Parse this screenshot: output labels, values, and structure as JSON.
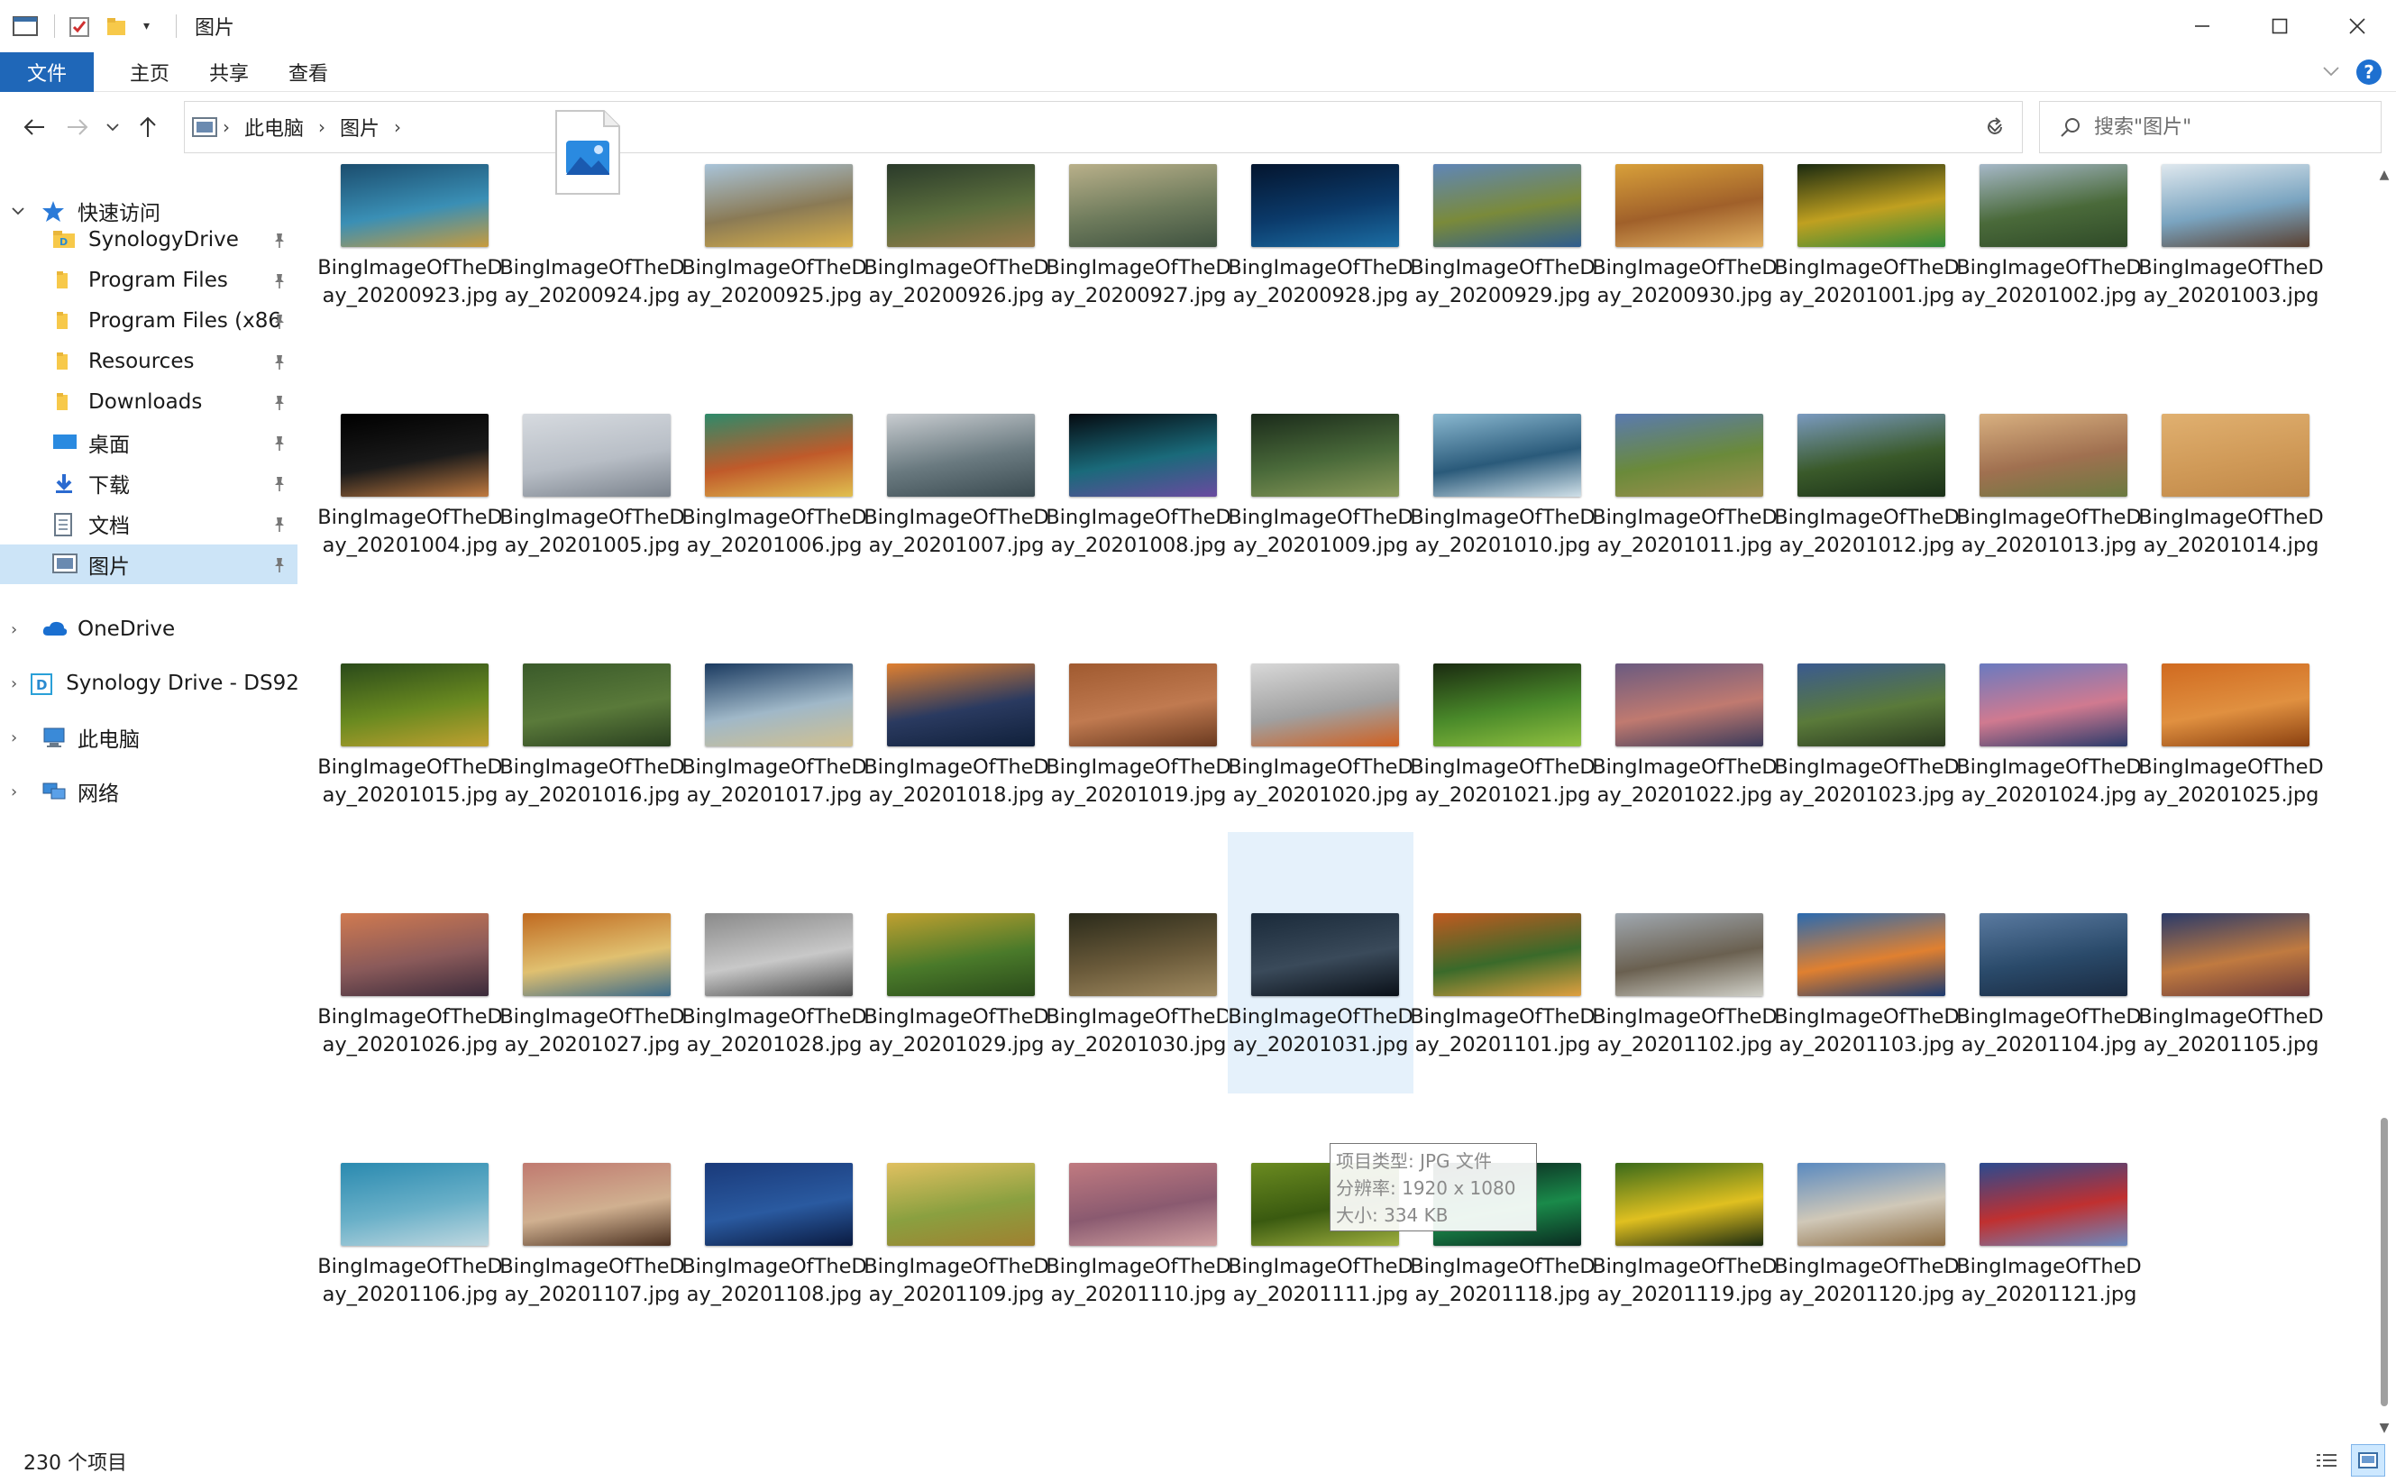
{
  "window": {
    "title": "图片",
    "controls": [
      "minimize",
      "maximize",
      "close"
    ]
  },
  "ribbon": {
    "file_tab": "文件",
    "tabs": [
      "主页",
      "共享",
      "查看"
    ]
  },
  "address": {
    "crumbs": [
      "此电脑",
      "图片"
    ]
  },
  "search": {
    "placeholder": "搜索\"图片\""
  },
  "nav_pane": {
    "quick_access": "快速访问",
    "pinned": [
      {
        "label": "SynologyDrive",
        "icon": "synology-folder-icon"
      },
      {
        "label": "Program Files",
        "icon": "folder-icon"
      },
      {
        "label": "Program Files (x86",
        "icon": "folder-icon"
      },
      {
        "label": "Resources",
        "icon": "folder-icon"
      },
      {
        "label": "Downloads",
        "icon": "folder-icon"
      },
      {
        "label": "桌面",
        "icon": "desktop-icon"
      },
      {
        "label": "下载",
        "icon": "download-icon"
      },
      {
        "label": "文档",
        "icon": "documents-icon"
      },
      {
        "label": "图片",
        "icon": "pictures-icon",
        "selected": true
      }
    ],
    "roots": [
      {
        "label": "OneDrive",
        "icon": "onedrive-icon"
      },
      {
        "label": "Synology Drive - DS92(",
        "icon": "synology-drive-icon"
      },
      {
        "label": "此电脑",
        "icon": "this-pc-icon"
      },
      {
        "label": "网络",
        "icon": "network-icon"
      }
    ]
  },
  "files": [
    {
      "name": "BingImageOfTheDay_20200923.jpg",
      "colors": [
        "#1b4d6e",
        "#3a8fb5",
        "#c89b3c"
      ]
    },
    {
      "name": "BingImageOfTheDay_20200924.jpg",
      "colors": [
        "#ffffff",
        "#ffffff",
        "#ffffff"
      ],
      "generic_icon": true
    },
    {
      "name": "BingImageOfTheDay_20200925.jpg",
      "colors": [
        "#a9c4d9",
        "#8a7a55",
        "#d9b04a"
      ]
    },
    {
      "name": "BingImageOfTheDay_20200926.jpg",
      "colors": [
        "#2a3a2a",
        "#5b6e3d",
        "#9a7a4a"
      ]
    },
    {
      "name": "BingImageOfTheDay_20200927.jpg",
      "colors": [
        "#b9b08a",
        "#6e7b5c",
        "#3f5240"
      ]
    },
    {
      "name": "BingImageOfTheDay_20200928.jpg",
      "colors": [
        "#04152e",
        "#0b3a6a",
        "#1c6ea4"
      ]
    },
    {
      "name": "BingImageOfTheDay_20200929.jpg",
      "colors": [
        "#5f86b8",
        "#7a8a3a",
        "#2f5d8f"
      ]
    },
    {
      "name": "BingImageOfTheDay_20200930.jpg",
      "colors": [
        "#d8a03a",
        "#a0602a",
        "#e0b060"
      ]
    },
    {
      "name": "BingImageOfTheDay_20201001.jpg",
      "colors": [
        "#1a2a10",
        "#c0a020",
        "#2f8a3a"
      ]
    },
    {
      "name": "BingImageOfTheDay_20201002.jpg",
      "colors": [
        "#a6b8c8",
        "#4a6a3a",
        "#2f4a28"
      ]
    },
    {
      "name": "BingImageOfTheDay_20201003.jpg",
      "colors": [
        "#dfe8ee",
        "#7aa4c0",
        "#5a4030"
      ]
    },
    {
      "name": "BingImageOfTheDay_20201004.jpg",
      "colors": [
        "#000000",
        "#1a1a1a",
        "#c07a40"
      ]
    },
    {
      "name": "BingImageOfTheDay_20201005.jpg",
      "colors": [
        "#d6dadf",
        "#b8bec6",
        "#7a828c"
      ]
    },
    {
      "name": "BingImageOfTheDay_20201006.jpg",
      "colors": [
        "#2e8a6a",
        "#c05a2a",
        "#e0c050"
      ]
    },
    {
      "name": "BingImageOfTheDay_20201007.jpg",
      "colors": [
        "#c8ccd0",
        "#6a7a80",
        "#3a4a50"
      ]
    },
    {
      "name": "BingImageOfTheDay_20201008.jpg",
      "colors": [
        "#050a10",
        "#1a6a7a",
        "#6a4aa0"
      ]
    },
    {
      "name": "BingImageOfTheDay_20201009.jpg",
      "colors": [
        "#1a2a1a",
        "#4a6a3a",
        "#8a9a5a"
      ]
    },
    {
      "name": "BingImageOfTheDay_20201010.jpg",
      "colors": [
        "#8ab8d0",
        "#2a5a7a",
        "#d0e0e8"
      ]
    },
    {
      "name": "BingImageOfTheDay_20201011.jpg",
      "colors": [
        "#5a7ab0",
        "#6a8a3a",
        "#a09050"
      ]
    },
    {
      "name": "BingImageOfTheDay_20201012.jpg",
      "colors": [
        "#7a9ac0",
        "#3a5a2a",
        "#1a3018"
      ]
    },
    {
      "name": "BingImageOfTheDay_20201013.jpg",
      "colors": [
        "#d8b080",
        "#a07050",
        "#6a7a40"
      ]
    },
    {
      "name": "BingImageOfTheDay_20201014.jpg",
      "colors": [
        "#e0b070",
        "#d09a58",
        "#c08848"
      ]
    },
    {
      "name": "BingImageOfTheDay_20201015.jpg",
      "colors": [
        "#2a4a1a",
        "#6a8a20",
        "#c0a030"
      ]
    },
    {
      "name": "BingImageOfTheDay_20201016.jpg",
      "colors": [
        "#3a5a2a",
        "#5a7a3a",
        "#2a4020"
      ]
    },
    {
      "name": "BingImageOfTheDay_20201017.jpg",
      "colors": [
        "#1a3a60",
        "#a0b8c8",
        "#d0c090"
      ]
    },
    {
      "name": "BingImageOfTheDay_20201018.jpg",
      "colors": [
        "#e08030",
        "#2a3a60",
        "#10203a"
      ]
    },
    {
      "name": "BingImageOfTheDay_20201019.jpg",
      "colors": [
        "#a05a30",
        "#c07a50",
        "#6a3a20"
      ]
    },
    {
      "name": "BingImageOfTheDay_20201020.jpg",
      "colors": [
        "#d8d8d8",
        "#a0a0a0",
        "#d06020"
      ]
    },
    {
      "name": "BingImageOfTheDay_20201021.jpg",
      "colors": [
        "#1a2a10",
        "#4a8a2a",
        "#90c040"
      ]
    },
    {
      "name": "BingImageOfTheDay_20201022.jpg",
      "colors": [
        "#6a5a80",
        "#c07a70",
        "#3a3a5a"
      ]
    },
    {
      "name": "BingImageOfTheDay_20201023.jpg",
      "colors": [
        "#3a5a90",
        "#5a7a3a",
        "#2a3a20"
      ]
    },
    {
      "name": "BingImageOfTheDay_20201024.jpg",
      "colors": [
        "#6a7ac0",
        "#d07a90",
        "#2a3a6a"
      ]
    },
    {
      "name": "BingImageOfTheDay_20201025.jpg",
      "colors": [
        "#d06a20",
        "#e09040",
        "#8a4010"
      ]
    },
    {
      "name": "BingImageOfTheDay_20201026.jpg",
      "colors": [
        "#d07a50",
        "#8a5a5a",
        "#3a2a3a"
      ]
    },
    {
      "name": "BingImageOfTheDay_20201027.jpg",
      "colors": [
        "#c06a20",
        "#e0c070",
        "#3a6a8a"
      ]
    },
    {
      "name": "BingImageOfTheDay_20201028.jpg",
      "colors": [
        "#8a8a8a",
        "#c8c8c8",
        "#4a4a4a"
      ]
    },
    {
      "name": "BingImageOfTheDay_20201029.jpg",
      "colors": [
        "#c0a030",
        "#4a7a2a",
        "#2a4a1a"
      ]
    },
    {
      "name": "BingImageOfTheDay_20201030.jpg",
      "colors": [
        "#2a2a1a",
        "#6a5a3a",
        "#a08a60"
      ]
    },
    {
      "name": "BingImageOfTheDay_20201031.jpg",
      "colors": [
        "#1a2a3a",
        "#3a4a5a",
        "#0a1018"
      ],
      "hover": true
    },
    {
      "name": "BingImageOfTheDay_20201101.jpg",
      "colors": [
        "#c05a20",
        "#3a6a2a",
        "#e0a040"
      ]
    },
    {
      "name": "BingImageOfTheDay_20201102.jpg",
      "colors": [
        "#a0a8b0",
        "#6a6050",
        "#d0d0c8"
      ]
    },
    {
      "name": "BingImageOfTheDay_20201103.jpg",
      "colors": [
        "#2a6ab0",
        "#e08030",
        "#1a3a70"
      ]
    },
    {
      "name": "BingImageOfTheDay_20201104.jpg",
      "colors": [
        "#5a7aa0",
        "#2a4a6a",
        "#1a2a40"
      ]
    },
    {
      "name": "BingImageOfTheDay_20201105.jpg",
      "colors": [
        "#2a3a6a",
        "#c07a40",
        "#6a3a3a"
      ]
    },
    {
      "name": "BingImageOfTheDay_20201106.jpg",
      "colors": [
        "#2a8ab0",
        "#6ab0c8",
        "#c0d8e0"
      ]
    },
    {
      "name": "BingImageOfTheDay_20201107.jpg",
      "colors": [
        "#c07a70",
        "#d0b090",
        "#4a3020"
      ]
    },
    {
      "name": "BingImageOfTheDay_20201108.jpg",
      "colors": [
        "#1a3a7a",
        "#2a5aa0",
        "#0a1a40"
      ]
    },
    {
      "name": "BingImageOfTheDay_20201109.jpg",
      "colors": [
        "#e0c060",
        "#8aa040",
        "#a08030"
      ]
    },
    {
      "name": "BingImageOfTheDay_20201110.jpg",
      "colors": [
        "#c07a80",
        "#8a5a70",
        "#d0a0a0"
      ]
    },
    {
      "name": "BingImageOfTheDay_20201111.jpg",
      "colors": [
        "#6a8a20",
        "#3a5a10",
        "#a0b040"
      ]
    },
    {
      "name": "BingImageOfTheDay_20201118.jpg",
      "colors": [
        "#0a1a1a",
        "#1a8a4a",
        "#0a2a20"
      ]
    },
    {
      "name": "BingImageOfTheDay_20201119.jpg",
      "colors": [
        "#3a6a1a",
        "#e0c020",
        "#1a2a10"
      ]
    },
    {
      "name": "BingImageOfTheDay_20201120.jpg",
      "colors": [
        "#5a8ac0",
        "#d0c8b8",
        "#8a6a40"
      ]
    },
    {
      "name": "BingImageOfTheDay_20201121.jpg",
      "colors": [
        "#2a4a90",
        "#c03030",
        "#6a8ac0"
      ]
    }
  ],
  "tooltip": {
    "type": "项目类型: JPG 文件",
    "resolution": "分辨率: 1920 x 1080",
    "size": "大小: 334 KB"
  },
  "status": {
    "item_count": "230 个项目"
  }
}
